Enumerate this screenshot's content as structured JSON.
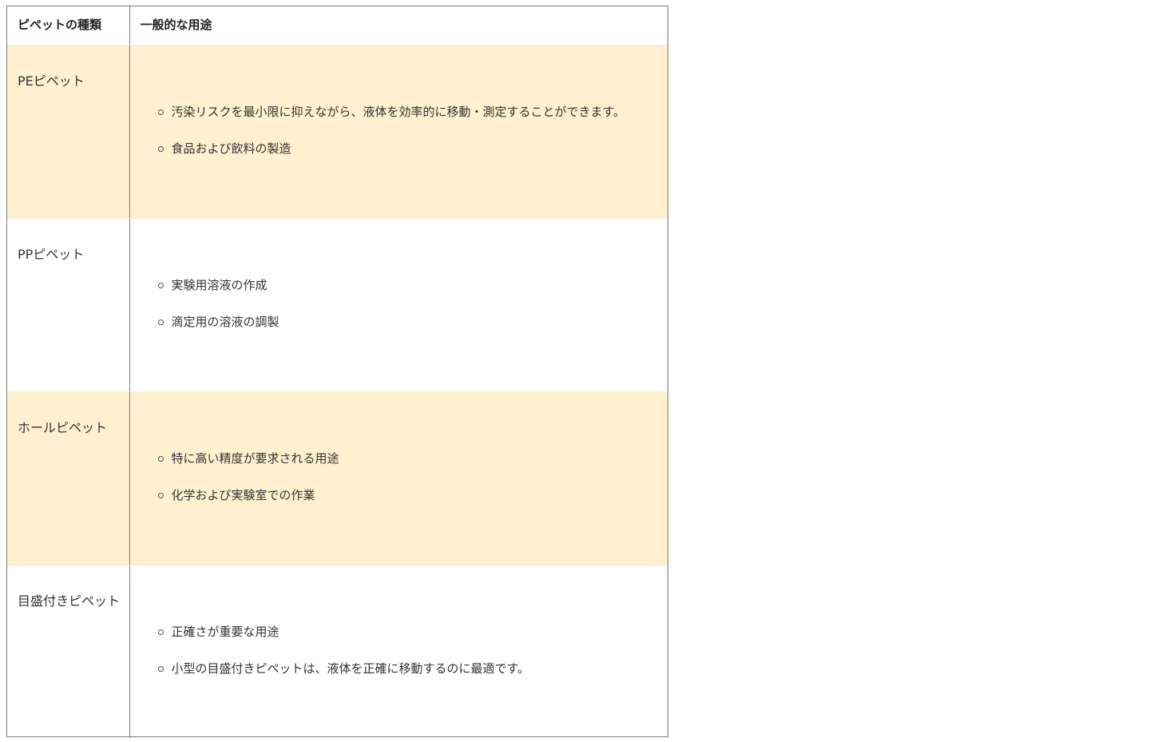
{
  "table": {
    "headers": [
      "ピペットの種類",
      "一般的な用途"
    ],
    "rows": [
      {
        "type": "PEピペット",
        "uses": [
          "汚染リスクを最小限に抑えながら、液体を効率的に移動・測定することができます。",
          "食品および飲料の製造"
        ]
      },
      {
        "type": "PPピペット",
        "uses": [
          "実験用溶液の作成",
          "滴定用の溶液の調製"
        ]
      },
      {
        "type": "ホールピペット",
        "uses": [
          "特に高い精度が要求される用途",
          "化学および実験室での作業"
        ]
      },
      {
        "type": "目盛付きピペット",
        "uses": [
          "正確さが重要な用途",
          "小型の目盛付きピペットは、液体を正確に移動するのに最適です。"
        ]
      }
    ]
  },
  "colors": {
    "shaded_row": "#fff0cf",
    "border": "#7a7a7a",
    "text": "#333333"
  }
}
